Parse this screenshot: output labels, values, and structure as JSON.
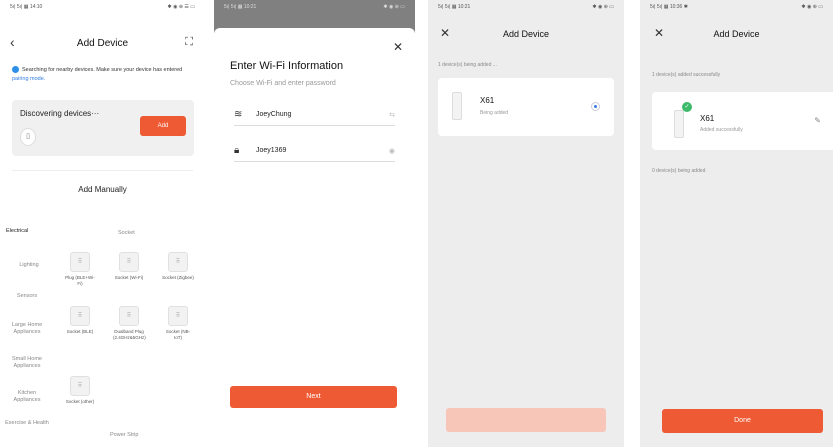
{
  "screen1": {
    "status_left": "5ı| 5ı| ▦ 14:10",
    "status_right": "✱ ◉ ⊕ ☰ ▭",
    "title": "Add Device",
    "hint_text": "Searching for nearby devices. Make sure your device has entered ",
    "hint_link": "pairing mode.",
    "discovering": "Discovering devices···",
    "add_label": "Add",
    "manual_title": "Add Manually",
    "categories": [
      "Electrical",
      "Lighting",
      "Sensors",
      "Large Home Appliances",
      "Small Home Appliances",
      "Kitchen Appliances",
      "Exercise & Health"
    ],
    "sub_socket": "Socket",
    "sub_power_strip": "Power Strip",
    "tiles": [
      "Plug (BLE+Wi-Fi)",
      "Socket (Wi-Fi)",
      "Socket (Zigbee)",
      "Socket (BLE)",
      "Dualband Plug (2.4GHz&5GHz)",
      "Socket (NB-IoT)",
      "Socket (other)"
    ]
  },
  "screen2": {
    "status_left": "5ı| 5ı| ▦ 10:21",
    "status_right": "✱ ◉ ⊕ ▭",
    "title": "Enter Wi-Fi Information",
    "subtitle": "Choose Wi-Fi and enter password",
    "wifi_name": "JoeyChung",
    "password": "Joey1369",
    "next_label": "Next"
  },
  "screen3": {
    "status_left": "5ı| 5ı| ▦ 10:21",
    "status_right": "✱ ◉ ⊕ ▭",
    "title": "Add Device",
    "section": "1 device(s) being added ...",
    "device_name": "X61",
    "device_status": "Being added"
  },
  "screen4": {
    "status_left": "5ı| 5ı| ▦ 10:36 ✱",
    "status_right": "✱ ◉ ⊕ ▭",
    "title": "Add Device",
    "section": "1 device(s) added successfully",
    "device_name": "X61",
    "device_status": "Added successfully",
    "section2": "0 device(s) being added",
    "done_label": "Done"
  }
}
